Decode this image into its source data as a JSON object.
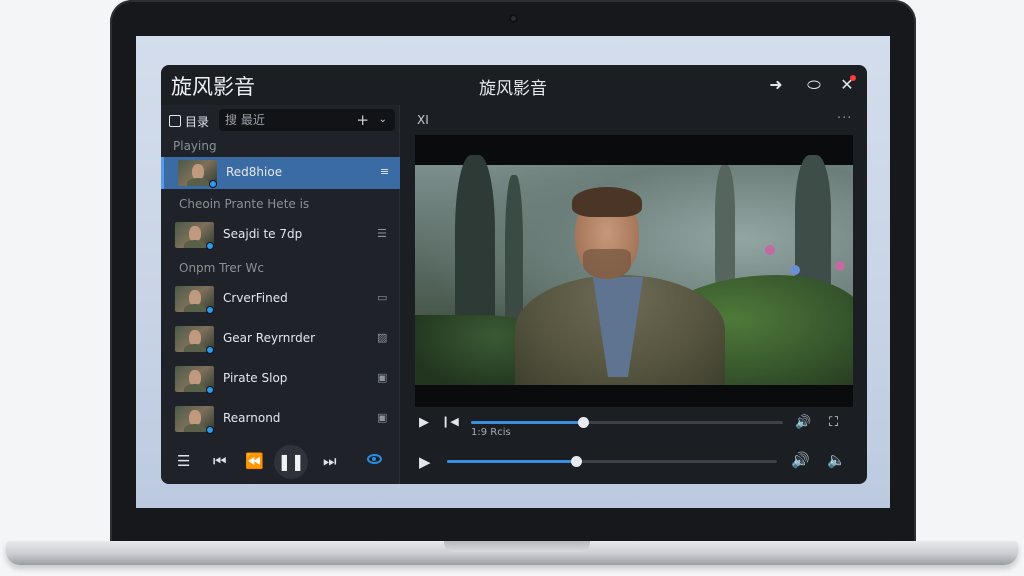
{
  "app": {
    "name": "旋风影音",
    "window_title": "旋风影音",
    "window_buttons": {
      "min": "➜",
      "max": "⬭",
      "close": "✕"
    }
  },
  "sidebar": {
    "tab_label": "目录",
    "search_text": "搜 最近",
    "add_icon": "+",
    "chevron_icon": "⌄",
    "groups": {
      "playing": "Playing",
      "g2": "Cheoin Prante Hete is",
      "g3": "Onpm Trer Wc"
    },
    "items": [
      {
        "title": "Red8hioe",
        "icon": "≡",
        "active": true
      },
      {
        "title": "Seajdi te 7dp",
        "icon": "☰",
        "active": false
      },
      {
        "title": "CrverFined",
        "icon": "▭",
        "active": false
      },
      {
        "title": "Gear Reyrnrder",
        "icon": "▨",
        "active": false
      },
      {
        "title": "Pirate Slop",
        "icon": "▣",
        "active": false
      },
      {
        "title": "Rearnond",
        "icon": "▣",
        "active": false
      }
    ],
    "controls": {
      "list": "☰",
      "prev": "⏮",
      "rewind": "⏪",
      "pause": "❚❚",
      "next": "⏭"
    }
  },
  "main": {
    "toolbar_left": "ΧI",
    "more": "···",
    "player": {
      "row1": {
        "play": "▶",
        "step": "❙◀",
        "time": "1:9 Rcis",
        "volume_icon": "🔊",
        "fullscreen_icon": "⛶",
        "progress": 0.36
      },
      "row2": {
        "play": "▶",
        "volume_icon": "🔊",
        "speaker_icon": "🔈",
        "progress": 0.39
      }
    }
  },
  "colors": {
    "accent": "#3b8ee0",
    "active_item": "#3a6ba5",
    "window_bg": "#1b1e23"
  }
}
